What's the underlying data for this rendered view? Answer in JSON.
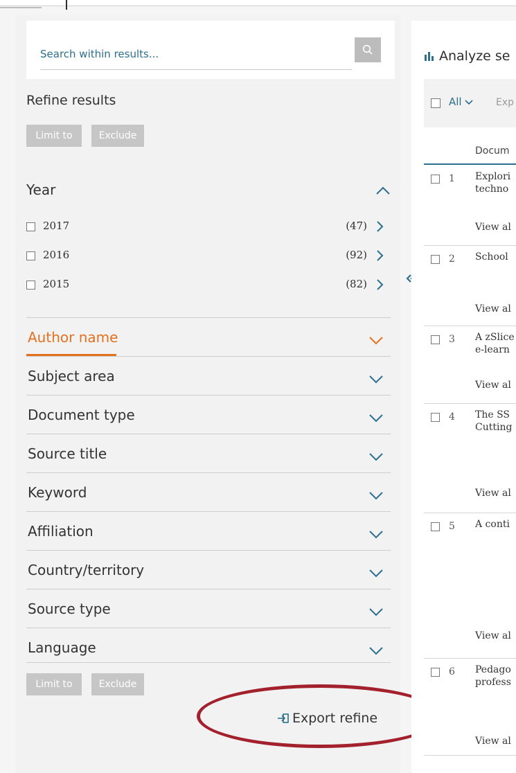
{
  "search": {
    "placeholder": "Search within results..."
  },
  "refine": {
    "title": "Refine results",
    "limit_label": "Limit to",
    "exclude_label": "Exclude"
  },
  "year": {
    "title": "Year",
    "items": [
      {
        "label": "2017",
        "count": "(47)"
      },
      {
        "label": "2016",
        "count": "(92)"
      },
      {
        "label": "2015",
        "count": "(82)"
      }
    ]
  },
  "facets": [
    {
      "label": "Author name",
      "active": true
    },
    {
      "label": "Subject area"
    },
    {
      "label": "Document type"
    },
    {
      "label": "Source title"
    },
    {
      "label": "Keyword"
    },
    {
      "label": "Affiliation"
    },
    {
      "label": "Country/territory"
    },
    {
      "label": "Source type"
    },
    {
      "label": "Language"
    }
  ],
  "export": {
    "label": "Export refine"
  },
  "results": {
    "analyze_label": "Analyze se",
    "all_label": "All",
    "export_label": "Exp",
    "column_header": "Docum",
    "items": [
      {
        "num": "1",
        "title": "Explori\ntechno",
        "view": "View al"
      },
      {
        "num": "2",
        "title": "School",
        "view": "View al"
      },
      {
        "num": "3",
        "title": "A zSlice\ne-learn",
        "view": "View al"
      },
      {
        "num": "4",
        "title": "The SS\nCutting",
        "view": "View al"
      },
      {
        "num": "5",
        "title": "A conti",
        "view": "View al"
      },
      {
        "num": "6",
        "title": "Pedago\nprofess",
        "view": "View al"
      }
    ]
  },
  "colors": {
    "accent": "#e4711f",
    "link": "#2c6f8e",
    "highlight_oval": "#a3202d"
  }
}
